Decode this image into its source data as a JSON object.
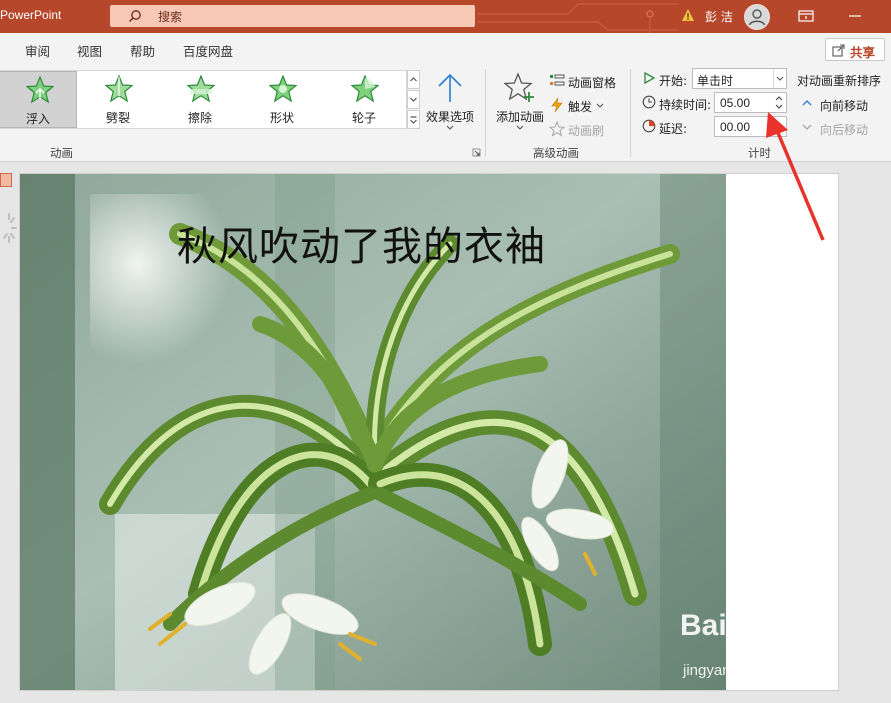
{
  "titlebar": {
    "app_name": "PowerPoint",
    "search_placeholder": "搜索",
    "user_name": "彭 洁",
    "bg_color": "#b7472a"
  },
  "tabs": [
    {
      "label": "审阅"
    },
    {
      "label": "视图"
    },
    {
      "label": "帮助"
    },
    {
      "label": "百度网盘"
    }
  ],
  "share_label": "共享",
  "ribbon": {
    "animation_group": {
      "label": "动画",
      "effects": [
        {
          "label": "浮入",
          "icon": "star-float-in-icon",
          "selected": true
        },
        {
          "label": "劈裂",
          "icon": "star-split-icon",
          "selected": false
        },
        {
          "label": "擦除",
          "icon": "star-wipe-icon",
          "selected": false
        },
        {
          "label": "形状",
          "icon": "star-shape-icon",
          "selected": false
        },
        {
          "label": "轮子",
          "icon": "star-wheel-icon",
          "selected": false
        }
      ],
      "effect_options_label": "效果选项"
    },
    "advanced_group": {
      "label": "高级动画",
      "add_animation_label": "添加动画",
      "animation_pane_label": "动画窗格",
      "trigger_label": "触发",
      "painter_label": "动画刷"
    },
    "timing_group": {
      "label": "计时",
      "start_label": "开始:",
      "start_value": "单击时",
      "duration_label": "持续时间:",
      "duration_value": "05.00",
      "delay_label": "延迟:",
      "delay_value": "00.00",
      "reorder_title": "对动画重新排序",
      "move_earlier_label": "向前移动",
      "move_later_label": "向后移动"
    }
  },
  "slide": {
    "title": "秋风吹动了我的衣袖"
  },
  "watermark": {
    "main": "Bai 经验",
    "sub": "jingyan.baidu.com"
  }
}
